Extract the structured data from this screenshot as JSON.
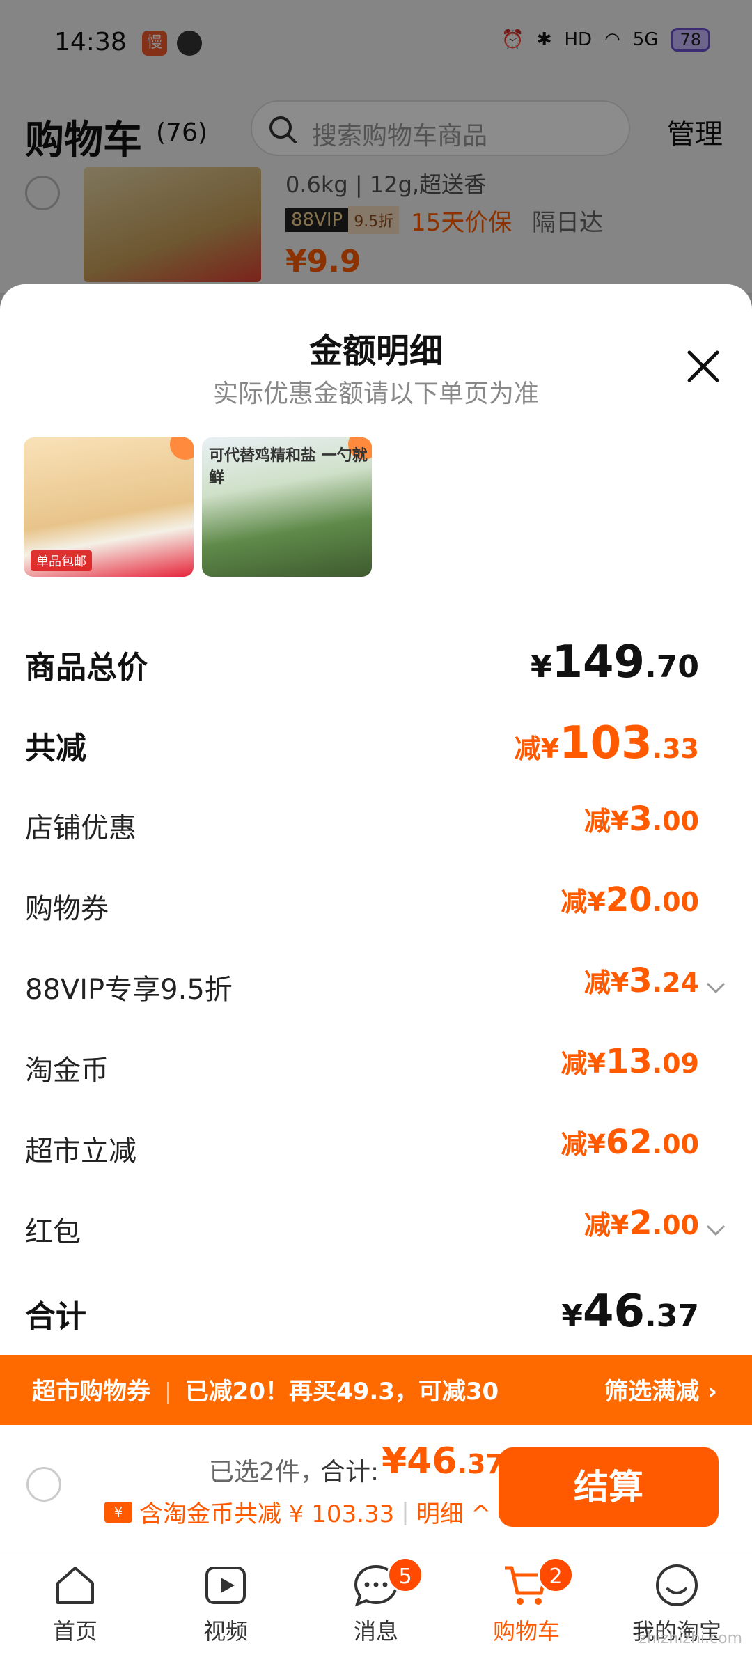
{
  "status": {
    "time": "14:38",
    "battery": "78",
    "network": "5G",
    "hd": "HD"
  },
  "cart_header": {
    "title": "购物车",
    "count": "(76)",
    "search_placeholder": "搜索购物车商品",
    "manage": "管理"
  },
  "bg_item": {
    "desc": "0.6kg | 12g,超送香",
    "vip_a": "88VIP",
    "vip_b": "9.5折",
    "guarantee": "15天价保",
    "delivery": "隔日达",
    "price": "¥9.9"
  },
  "sheet": {
    "title": "金额明细",
    "subtitle": "实际优惠金额请以下单页为准",
    "thumb1_label": "单品包邮",
    "thumb2_label": "可代替鸡精和盐 一勺就鲜",
    "rows": [
      {
        "label": "商品总价",
        "prefix": "¥",
        "big": "149",
        "small": ".70"
      },
      {
        "label": "共减",
        "prefix": "减¥",
        "big": "103",
        "small": ".33"
      },
      {
        "label": "店铺优惠",
        "prefix": "减¥",
        "big": "3",
        "small": ".00"
      },
      {
        "label": "购物券",
        "prefix": "减¥",
        "big": "20",
        "small": ".00"
      },
      {
        "label": "88VIP专享9.5折",
        "prefix": "减¥",
        "big": "3",
        "small": ".24"
      },
      {
        "label": "淘金币",
        "prefix": "减¥",
        "big": "13",
        "small": ".09"
      },
      {
        "label": "超市立减",
        "prefix": "减¥",
        "big": "62",
        "small": ".00"
      },
      {
        "label": "红包",
        "prefix": "减¥",
        "big": "2",
        "small": ".00"
      },
      {
        "label": "合计",
        "prefix": "¥",
        "big": "46",
        "small": ".37"
      }
    ]
  },
  "promo": {
    "left_a": "超市购物券",
    "left_b": "已减20！再买49.3，可减30",
    "right": "筛选满减 ›"
  },
  "checkout": {
    "selected": "已选2件，",
    "total_label": "合计:",
    "total_big": "¥46",
    "total_small": ".37",
    "coupon_text": "含淘金币共减 ¥ 103.33",
    "detail": "明细 ^",
    "button": "结算"
  },
  "tabs": [
    {
      "label": "首页",
      "icon": "home-icon"
    },
    {
      "label": "视频",
      "icon": "video-icon"
    },
    {
      "label": "消息",
      "icon": "message-icon",
      "badge": "5"
    },
    {
      "label": "购物车",
      "icon": "cart-icon",
      "badge": "2"
    },
    {
      "label": "我的淘宝",
      "icon": "profile-icon"
    }
  ],
  "watermark": "zhizhizhi.com",
  "colors": {
    "accent": "#ff5a00",
    "promo_bg": "#ff6a00"
  }
}
